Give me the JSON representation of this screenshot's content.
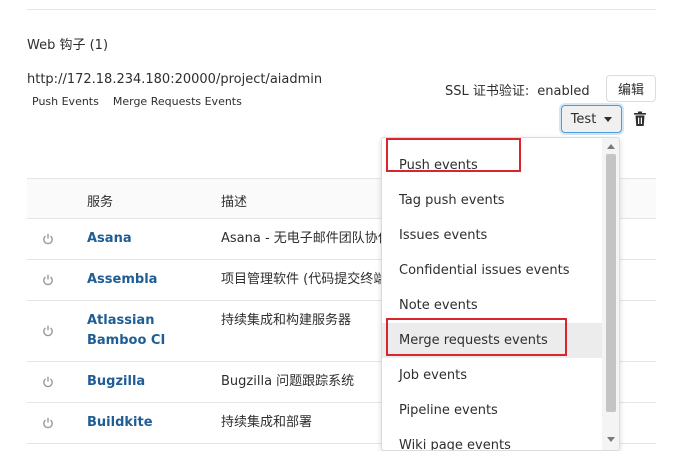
{
  "section": {
    "title": "Web 钩子 (1)"
  },
  "hook": {
    "url": "http://172.18.234.180:20000/project/aiadmin",
    "events": [
      "Push Events",
      "Merge Requests Events"
    ],
    "ssl_label": "SSL 证书验证:",
    "ssl_value": "enabled",
    "edit_label": "编辑",
    "test_label": "Test"
  },
  "table": {
    "headers": {
      "service": "服务",
      "description": "描述"
    },
    "rows": [
      {
        "name": "Asana",
        "description": "Asana - 无电子邮件团队协作"
      },
      {
        "name": "Assembla",
        "description": "项目管理软件 (代码提交终端)"
      },
      {
        "name": "Atlassian Bamboo CI",
        "description": "持续集成和构建服务器"
      },
      {
        "name": "Bugzilla",
        "description": "Bugzilla 问题跟踪系统"
      },
      {
        "name": "Buildkite",
        "description": "持续集成和部署"
      }
    ]
  },
  "dropdown": {
    "items": [
      "Push events",
      "Tag push events",
      "Issues events",
      "Confidential issues events",
      "Note events",
      "Merge requests events",
      "Job events",
      "Pipeline events",
      "Wiki page events"
    ],
    "hovered_item": "Merge requests events",
    "highlighted_items": [
      "Push events",
      "Merge requests events"
    ]
  },
  "colors": {
    "link": "#1f5d94",
    "highlight": "#d9262c",
    "focus": "#4f9cd8"
  },
  "icons": {
    "row_status": "power-icon",
    "delete": "trash-icon",
    "test_caret": "caret-down-icon"
  }
}
